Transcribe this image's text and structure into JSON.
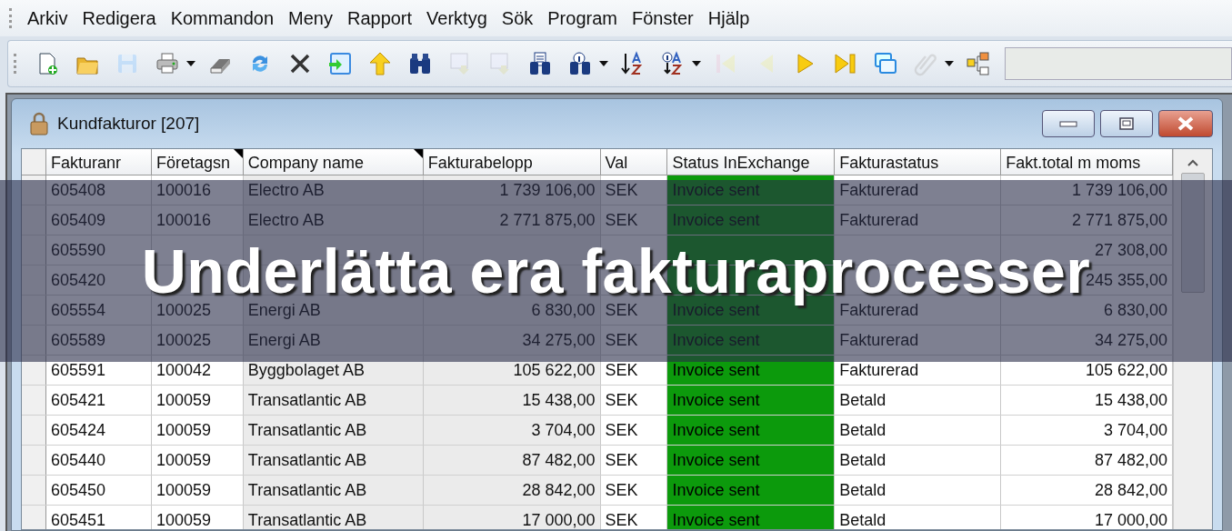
{
  "menu_bar": [
    "Arkiv",
    "Redigera",
    "Kommandon",
    "Meny",
    "Rapport",
    "Verktyg",
    "Sök",
    "Program",
    "Fönster",
    "Hjälp"
  ],
  "toolbar": [
    {
      "kind": "new",
      "disabled": false,
      "dropdown": false
    },
    {
      "kind": "open",
      "disabled": false,
      "dropdown": false
    },
    {
      "kind": "save",
      "disabled": true,
      "dropdown": false
    },
    {
      "kind": "print",
      "disabled": false,
      "dropdown": true
    },
    {
      "kind": "erase",
      "disabled": false,
      "dropdown": false
    },
    {
      "kind": "refresh",
      "disabled": false,
      "dropdown": false
    },
    {
      "kind": "delete",
      "disabled": false,
      "dropdown": false
    },
    {
      "kind": "import",
      "disabled": false,
      "dropdown": false
    },
    {
      "kind": "up",
      "disabled": false,
      "dropdown": false
    },
    {
      "kind": "find",
      "disabled": false,
      "dropdown": false
    },
    {
      "kind": "fetch",
      "disabled": true,
      "dropdown": false
    },
    {
      "kind": "fetch",
      "disabled": true,
      "dropdown": false
    },
    {
      "kind": "findlist",
      "disabled": false,
      "dropdown": false
    },
    {
      "kind": "findinfo",
      "disabled": false,
      "dropdown": true
    },
    {
      "kind": "sort",
      "disabled": false,
      "dropdown": false
    },
    {
      "kind": "sortinfo",
      "disabled": false,
      "dropdown": true
    },
    {
      "kind": "first",
      "disabled": true,
      "dropdown": false
    },
    {
      "kind": "previous",
      "disabled": true,
      "dropdown": false
    },
    {
      "kind": "next",
      "disabled": false,
      "dropdown": false
    },
    {
      "kind": "last",
      "disabled": false,
      "dropdown": false
    },
    {
      "kind": "windows",
      "disabled": false,
      "dropdown": false
    },
    {
      "kind": "attach",
      "disabled": true,
      "dropdown": true
    },
    {
      "kind": "tree",
      "disabled": false,
      "dropdown": false
    }
  ],
  "window": {
    "title": "Kundfakturor [207]"
  },
  "table": {
    "columns": [
      {
        "label": "Fakturanr",
        "kind": "text",
        "shaded": false,
        "marked": false
      },
      {
        "label": "Företagsn",
        "kind": "text",
        "shaded": false,
        "marked": true
      },
      {
        "label": "Company name",
        "kind": "text",
        "shaded": true,
        "marked": true
      },
      {
        "label": "Fakturabelopp",
        "kind": "amount",
        "shaded": true,
        "marked": false
      },
      {
        "label": "Val",
        "kind": "text",
        "shaded": false,
        "marked": false
      },
      {
        "label": "Status InExchange",
        "kind": "status",
        "shaded": false,
        "marked": false
      },
      {
        "label": "Fakturastatus",
        "kind": "text",
        "shaded": false,
        "marked": false
      },
      {
        "label": "Fakt.total m moms",
        "kind": "amount",
        "shaded": false,
        "marked": false
      }
    ],
    "rows": [
      {
        "cells": [
          "605408",
          "100016",
          "Electro AB",
          "1 739 106,00",
          "SEK",
          "Invoice sent",
          "Fakturerad",
          "1 739 106,00"
        ]
      },
      {
        "cells": [
          "605409",
          "100016",
          "Electro AB",
          "2 771 875,00",
          "SEK",
          "Invoice sent",
          "Fakturerad",
          "2 771 875,00"
        ]
      },
      {
        "cells": [
          "605590",
          "",
          "",
          "",
          "",
          "",
          "",
          "27 308,00"
        ]
      },
      {
        "cells": [
          "605420",
          "",
          "",
          "",
          "",
          "",
          "",
          "245 355,00"
        ]
      },
      {
        "cells": [
          "605554",
          "100025",
          "Energi AB",
          "6 830,00",
          "SEK",
          "Invoice sent",
          "Fakturerad",
          "6 830,00"
        ]
      },
      {
        "cells": [
          "605589",
          "100025",
          "Energi AB",
          "34 275,00",
          "SEK",
          "Invoice sent",
          "Fakturerad",
          "34 275,00"
        ]
      },
      {
        "cells": [
          "605591",
          "100042",
          "Byggbolaget AB",
          "105 622,00",
          "SEK",
          "Invoice sent",
          "Fakturerad",
          "105 622,00"
        ]
      },
      {
        "cells": [
          "605421",
          "100059",
          "Transatlantic AB",
          "15 438,00",
          "SEK",
          "Invoice sent",
          "Betald",
          "15 438,00"
        ]
      },
      {
        "cells": [
          "605424",
          "100059",
          "Transatlantic AB",
          "3 704,00",
          "SEK",
          "Invoice sent",
          "Betald",
          "3 704,00"
        ]
      },
      {
        "cells": [
          "605440",
          "100059",
          "Transatlantic AB",
          "87 482,00",
          "SEK",
          "Invoice sent",
          "Betald",
          "87 482,00"
        ]
      },
      {
        "cells": [
          "605450",
          "100059",
          "Transatlantic AB",
          "28 842,00",
          "SEK",
          "Invoice sent",
          "Betald",
          "28 842,00"
        ]
      },
      {
        "cells": [
          "605451",
          "100059",
          "Transatlantic AB",
          "17 000,00",
          "SEK",
          "Invoice sent",
          "Betald",
          "17 000,00"
        ]
      }
    ]
  },
  "banner": {
    "text": "Underlätta era fakturaprocesser"
  }
}
